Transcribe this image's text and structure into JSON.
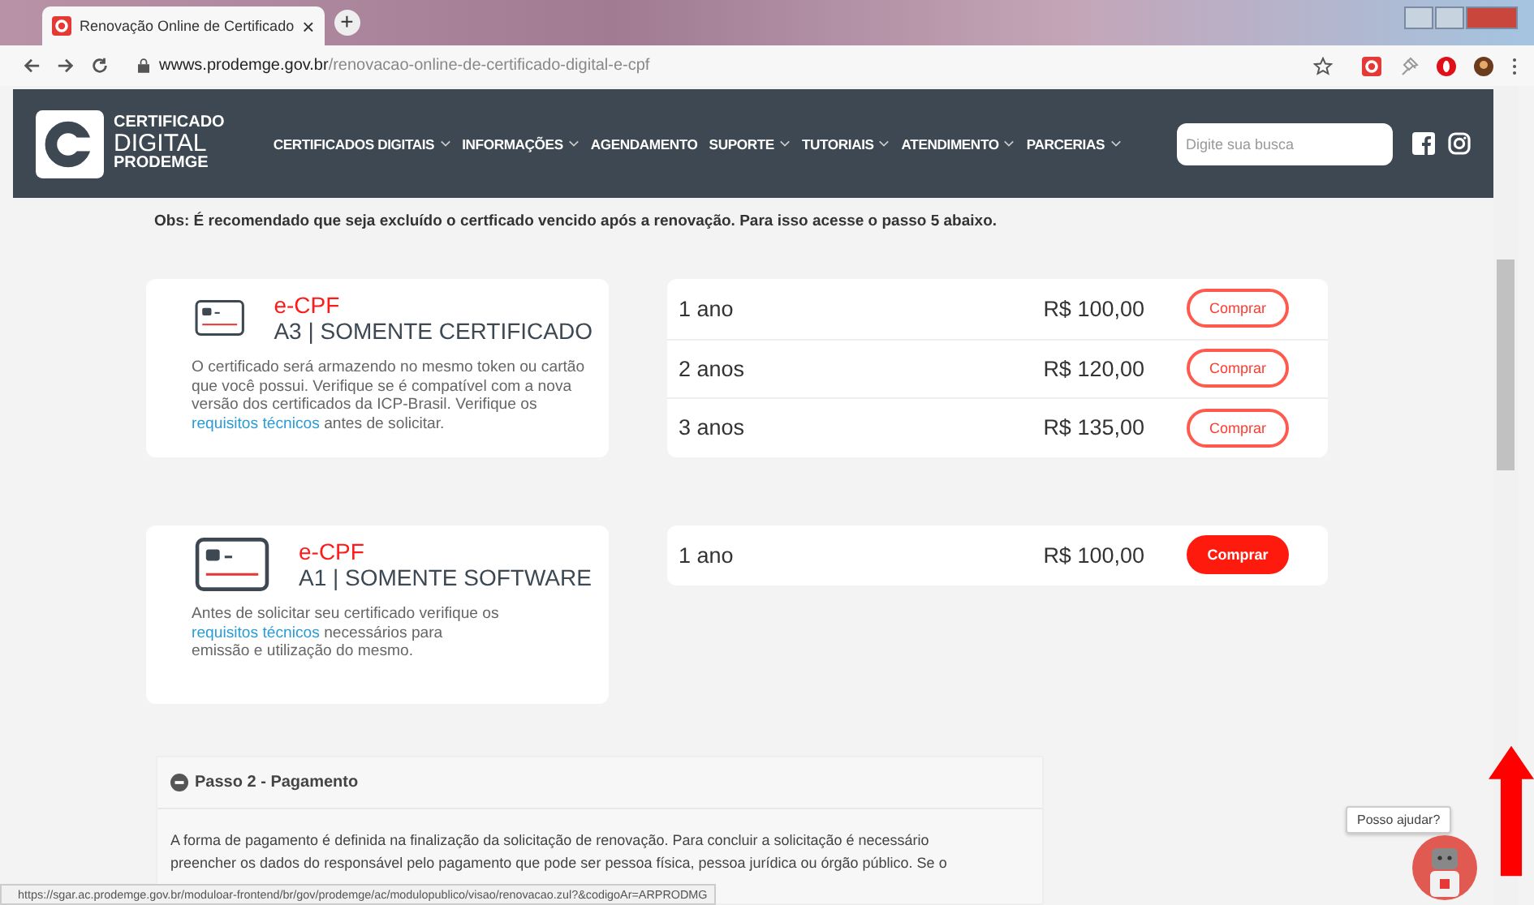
{
  "browser": {
    "tab_title": "Renovação Online de Certificado",
    "new_tab": "+",
    "close": "×",
    "url_domain": "wwws.prodemge.gov.br",
    "url_path": "/renovacao-online-de-certificado-digital-e-cpf"
  },
  "header": {
    "logo": [
      "CERTIFICADO",
      "DIGITAL",
      "PRODEMGE"
    ],
    "nav": [
      {
        "label": "CERTIFICADOS DIGITAIS",
        "dropdown": true
      },
      {
        "label": "INFORMAÇÕES",
        "dropdown": true
      },
      {
        "label": "AGENDAMENTO",
        "dropdown": false
      },
      {
        "label": "SUPORTE",
        "dropdown": true
      },
      {
        "label": "TUTORIAIS",
        "dropdown": true
      },
      {
        "label": "ATENDIMENTO",
        "dropdown": true
      },
      {
        "label": "PARCERIAS",
        "dropdown": true
      }
    ],
    "search": {
      "placeholder": "Digite sua busca"
    }
  },
  "notice": "Obs: É recomendado que seja excluído o certficado vencido após a renovação. Para isso acesse o passo 5 abaixo.",
  "products": [
    {
      "type": "e-CPF",
      "title": "A3 | SOMENTE CERTIFICADO",
      "desc_before": "O certificado será armazendo no mesmo token ou cartão que você possui. Verifique se é compatível com a nova versão dos certificados da ICP-Brasil. Verifique os",
      "link": "requisitos técnicos",
      "desc_after": "antes de solicitar.",
      "prices": [
        {
          "period": "1 ano",
          "price": "R$ 100,00",
          "button": "Comprar",
          "kind": "outline"
        },
        {
          "period": "2 anos",
          "price": "R$ 120,00",
          "button": "Comprar",
          "kind": "outline"
        },
        {
          "period": "3 anos",
          "price": "R$ 135,00",
          "button": "Comprar",
          "kind": "outline"
        }
      ]
    },
    {
      "type": "e-CPF",
      "title": "A1 | SOMENTE SOFTWARE",
      "desc_before": "Antes de solicitar seu certificado verifique os",
      "link": "requisitos técnicos",
      "desc_after": "necessários para emissão e utilização do mesmo.",
      "prices": [
        {
          "period": "1 ano",
          "price": "R$ 100,00",
          "button": "Comprar",
          "kind": "filled"
        }
      ]
    }
  ],
  "step": {
    "title": "Passo 2 - Pagamento",
    "expanded": true,
    "lines": [
      "A forma de pagamento é definida na finalização da solicitação de renovação. Para concluir a solicitação é necessário",
      "preencher os dados do responsável pelo pagamento que pode ser pessoa física, pessoa jurídica ou órgão público. Se o"
    ]
  },
  "status_url": "https://sgar.ac.prodemge.gov.br/moduloar-frontend/br/gov/prodemge/ac/modulopublico/visao/renovacao.zul?&codigoAr=ARPRODMG",
  "help": "Posso ajudar?"
}
